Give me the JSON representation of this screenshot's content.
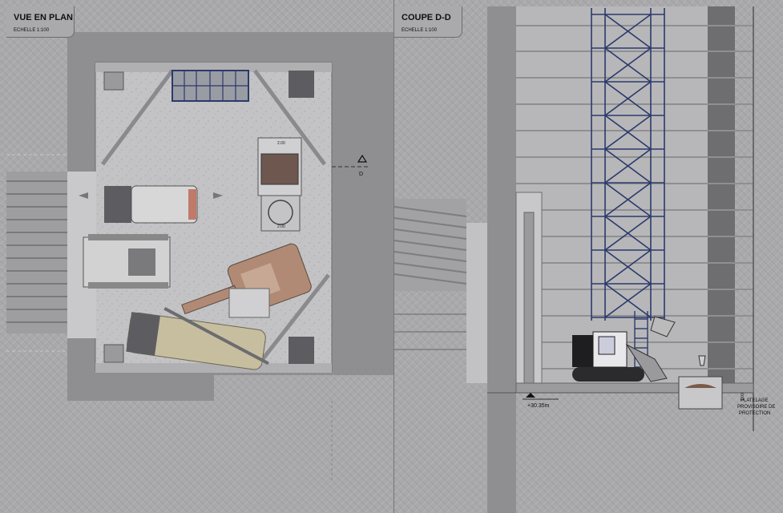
{
  "left_view": {
    "title": "VUE EN PLAN",
    "scale": "ECHELLE 1:100",
    "section_marker": "D",
    "dimension_a": "2.00",
    "dimension_b": "2.00"
  },
  "right_view": {
    "title": "COUPE D-D",
    "scale": "ECHELLE 1:100",
    "elevation": "+30.35m",
    "note_line_1": "PLATELAGE",
    "note_line_2": "PROVISOIRE DE",
    "note_line_3": "PROTECTION",
    "depth_label": "1.00"
  },
  "colors": {
    "background": "#a9a9ab",
    "wall": "#8d8d90",
    "floor": "#bebec0",
    "excavator": "#b08a74",
    "loader": "#c7bea0",
    "scaffold": "#2b3a6c",
    "dark_panel": "#5d5d61"
  }
}
